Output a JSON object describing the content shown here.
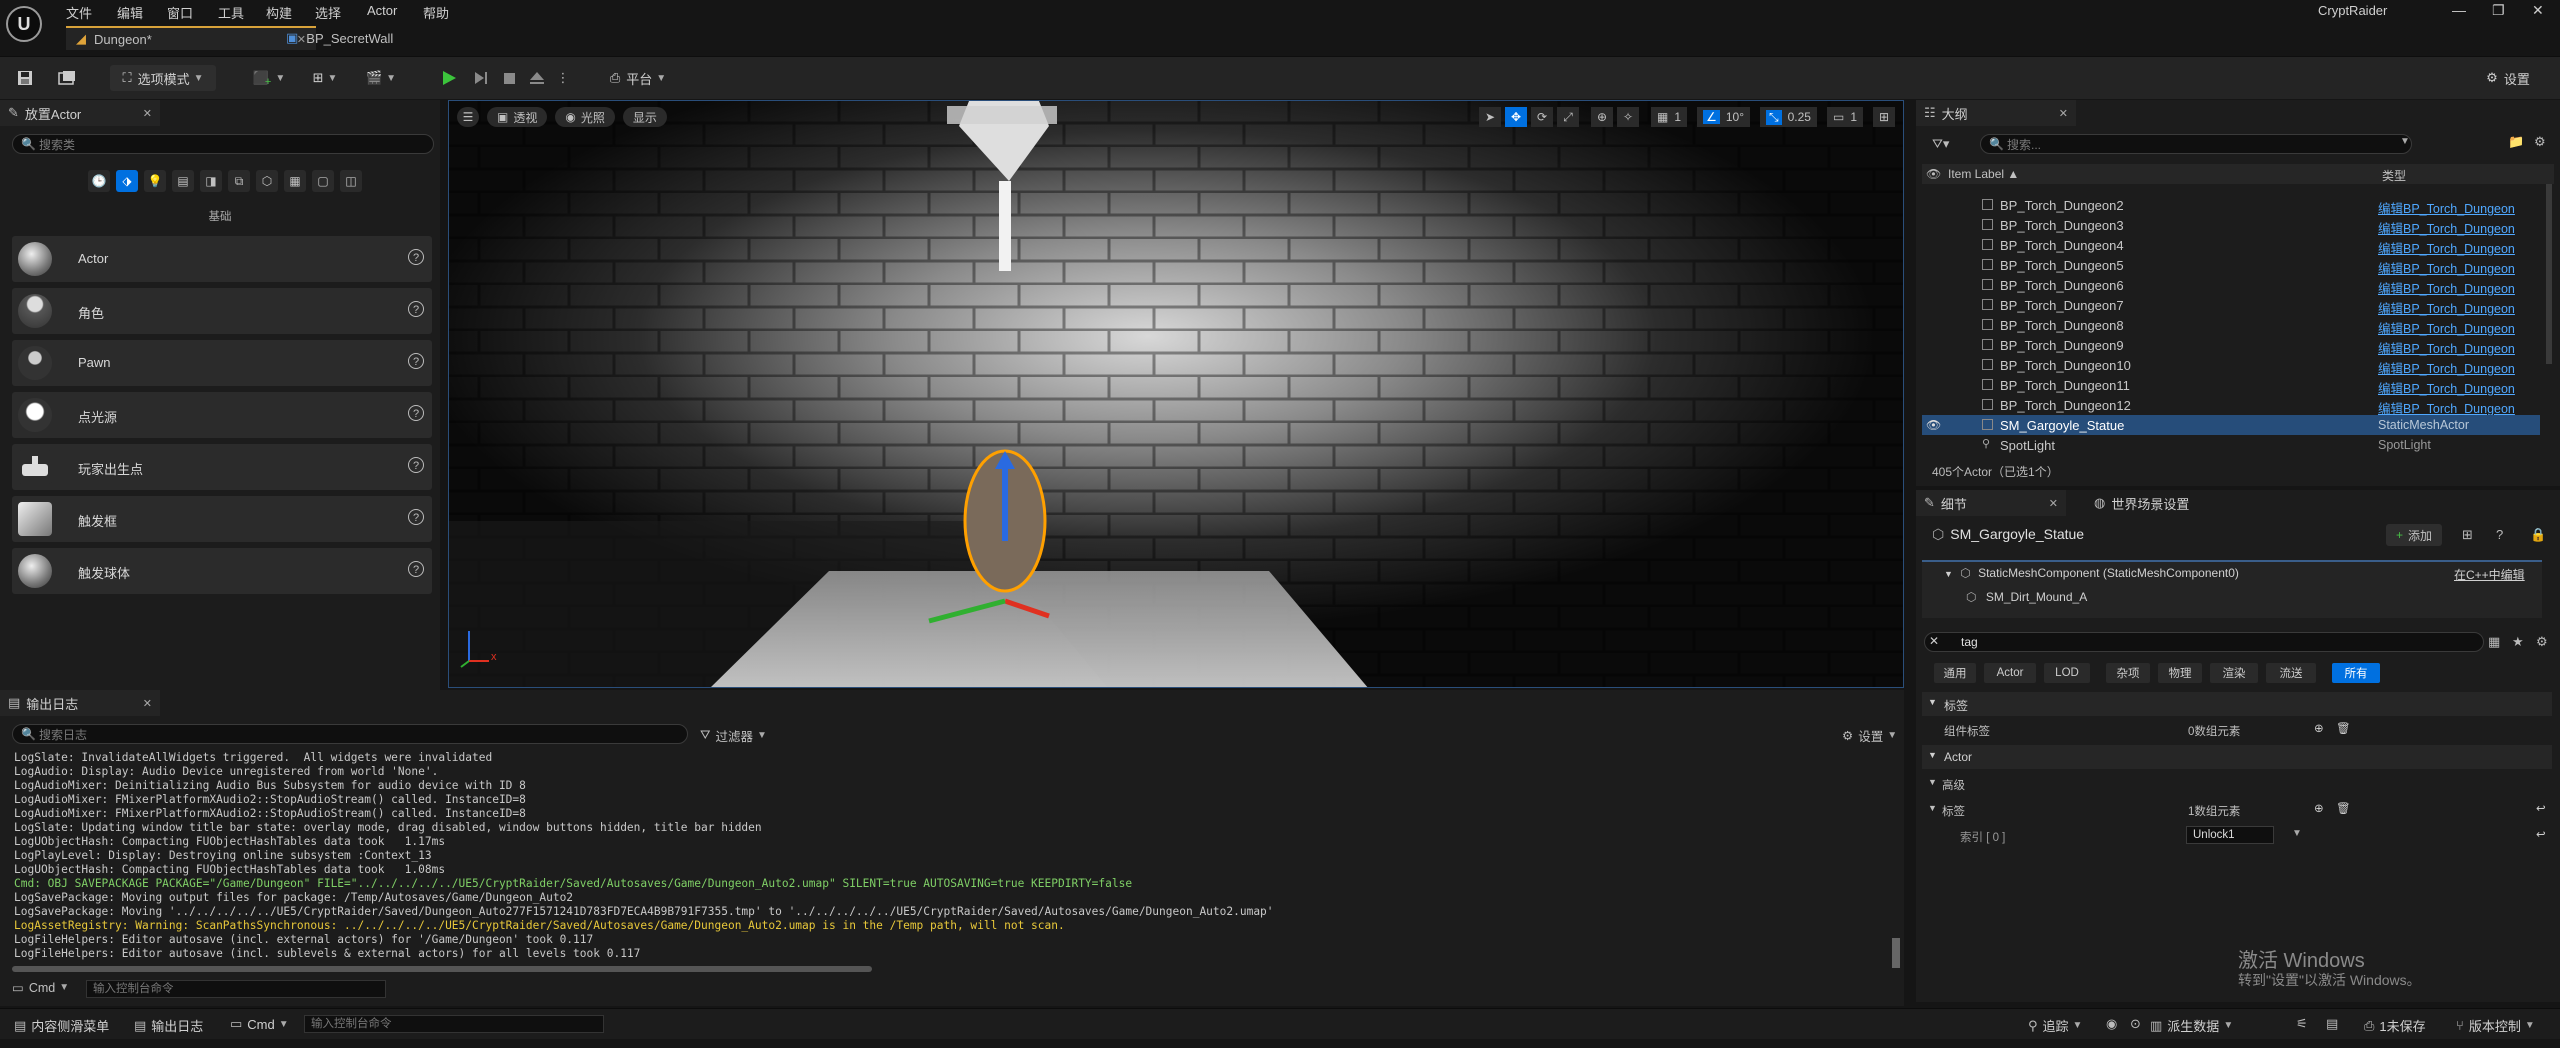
{
  "menu": {
    "items": [
      "文件",
      "编辑",
      "窗口",
      "工具",
      "构建",
      "选择",
      "Actor",
      "帮助"
    ],
    "project_name": "CryptRaider"
  },
  "doc_tabs": [
    {
      "label": "Dungeon*",
      "active": true
    },
    {
      "label": "BP_SecretWall",
      "active": false
    }
  ],
  "toolbar": {
    "mode_label": "选项模式",
    "platform_label": "平台",
    "settings_label": "设置"
  },
  "place_actors": {
    "tab_label": "放置Actor",
    "search_placeholder": "搜索类",
    "category_label": "基础",
    "items": [
      "Actor",
      "角色",
      "Pawn",
      "点光源",
      "玩家出生点",
      "触发框",
      "触发球体"
    ]
  },
  "viewport": {
    "perspective_label": "透视",
    "lighting_label": "光照",
    "show_label": "显示",
    "grid_value": "1",
    "angle_value": "10°",
    "scale_value": "0.25",
    "camera_speed": "1",
    "axis_x": "x"
  },
  "outliner": {
    "tab_label": "大纲",
    "search_placeholder": "搜索...",
    "col_label": "Item Label ▲",
    "col_type": "类型",
    "rows": [
      {
        "name": "BP_Torch_Dungeon2",
        "type": "编辑BP_Torch_Dungeon"
      },
      {
        "name": "BP_Torch_Dungeon3",
        "type": "编辑BP_Torch_Dungeon"
      },
      {
        "name": "BP_Torch_Dungeon4",
        "type": "编辑BP_Torch_Dungeon"
      },
      {
        "name": "BP_Torch_Dungeon5",
        "type": "编辑BP_Torch_Dungeon"
      },
      {
        "name": "BP_Torch_Dungeon6",
        "type": "编辑BP_Torch_Dungeon"
      },
      {
        "name": "BP_Torch_Dungeon7",
        "type": "编辑BP_Torch_Dungeon"
      },
      {
        "name": "BP_Torch_Dungeon8",
        "type": "编辑BP_Torch_Dungeon"
      },
      {
        "name": "BP_Torch_Dungeon9",
        "type": "编辑BP_Torch_Dungeon"
      },
      {
        "name": "BP_Torch_Dungeon10",
        "type": "编辑BP_Torch_Dungeon"
      },
      {
        "name": "BP_Torch_Dungeon11",
        "type": "编辑BP_Torch_Dungeon"
      },
      {
        "name": "BP_Torch_Dungeon12",
        "type": "编辑BP_Torch_Dungeon"
      }
    ],
    "selected_row": {
      "name": "SM_Gargoyle_Statue",
      "type": "StaticMeshActor"
    },
    "last_row": {
      "name": "SpotLight",
      "type": "SpotLight"
    },
    "count_label": "405个Actor（已选1个）"
  },
  "details": {
    "tab_label": "细节",
    "world_tab_label": "世界场景设置",
    "actor_name": "SM_Gargoyle_Statue",
    "add_label": "添加",
    "component_label": "StaticMeshComponent (StaticMeshComponent0)",
    "edit_cpp_label": "在C++中编辑",
    "child_component": "SM_Dirt_Mound_A",
    "search_value": "tag",
    "filter_tabs": [
      "通用",
      "Actor",
      "LOD",
      "杂项",
      "物理",
      "渲染",
      "流送",
      "所有"
    ],
    "section_tags": "标签",
    "component_tags_label": "组件标签",
    "component_tags_value": "0数组元素",
    "section_actor": "Actor",
    "advanced_label": "高级",
    "tags_label": "标签",
    "tags_value": "1数组元素",
    "index_label": "索引 [ 0 ]",
    "index_value": "Unlock1"
  },
  "output_log": {
    "tab_label": "输出日志",
    "search_placeholder": "搜索日志",
    "filter_label": "过滤器",
    "settings_label": "设置",
    "lines": [
      {
        "text": "LogSlate: InvalidateAllWidgets triggered.  All widgets were invalidated",
        "kind": "normal"
      },
      {
        "text": "LogAudio: Display: Audio Device unregistered from world 'None'.",
        "kind": "normal"
      },
      {
        "text": "LogAudioMixer: Deinitializing Audio Bus Subsystem for audio device with ID 8",
        "kind": "normal"
      },
      {
        "text": "LogAudioMixer: FMixerPlatformXAudio2::StopAudioStream() called. InstanceID=8",
        "kind": "normal"
      },
      {
        "text": "LogAudioMixer: FMixerPlatformXAudio2::StopAudioStream() called. InstanceID=8",
        "kind": "normal"
      },
      {
        "text": "LogSlate: Updating window title bar state: overlay mode, drag disabled, window buttons hidden, title bar hidden",
        "kind": "normal"
      },
      {
        "text": "LogUObjectHash: Compacting FUObjectHashTables data took   1.17ms",
        "kind": "normal"
      },
      {
        "text": "LogPlayLevel: Display: Destroying online subsystem :Context_13",
        "kind": "normal"
      },
      {
        "text": "LogUObjectHash: Compacting FUObjectHashTables data took   1.08ms",
        "kind": "normal"
      },
      {
        "text": "Cmd: OBJ SAVEPACKAGE PACKAGE=\"/Game/Dungeon\" FILE=\"../../../../../UE5/CryptRaider/Saved/Autosaves/Game/Dungeon_Auto2.umap\" SILENT=true AUTOSAVING=true KEEPDIRTY=false",
        "kind": "cmd"
      },
      {
        "text": "LogSavePackage: Moving output files for package: /Temp/Autosaves/Game/Dungeon_Auto2",
        "kind": "normal"
      },
      {
        "text": "LogSavePackage: Moving '../../../../../UE5/CryptRaider/Saved/Dungeon_Auto277F1571241D783FD7ECA4B9B791F7355.tmp' to '../../../../../UE5/CryptRaider/Saved/Autosaves/Game/Dungeon_Auto2.umap'",
        "kind": "normal"
      },
      {
        "text": "LogAssetRegistry: Warning: ScanPathsSynchronous: ../../../../../UE5/CryptRaider/Saved/Autosaves/Game/Dungeon_Auto2.umap is in the /Temp path, will not scan.",
        "kind": "warn"
      },
      {
        "text": "LogFileHelpers: Editor autosave (incl. external actors) for '/Game/Dungeon' took 0.117",
        "kind": "normal"
      },
      {
        "text": "LogFileHelpers: Editor autosave (incl. sublevels & external actors) for all levels took 0.117",
        "kind": "normal"
      }
    ],
    "cmd_label": "Cmd",
    "cmd_placeholder": "输入控制台命令"
  },
  "statusbar": {
    "content_drawer": "内容侧滑菜单",
    "output_log": "输出日志",
    "cmd_label": "Cmd",
    "cmd_placeholder": "输入控制台命令",
    "trace_label": "追踪",
    "derived_data": "派生数据",
    "unsaved": "1未保存",
    "source_control": "版本控制"
  },
  "watermark": {
    "line1": "激活 Windows",
    "line2": "转到\"设置\"以激活 Windows。"
  },
  "colors": {
    "accent_blue": "#0070e0",
    "link_blue": "#4fa8ff",
    "play_green": "#3cc43c",
    "selection": "#264d7a",
    "warn_yellow": "#e8c83a",
    "cmd_green": "#7fcf66"
  }
}
